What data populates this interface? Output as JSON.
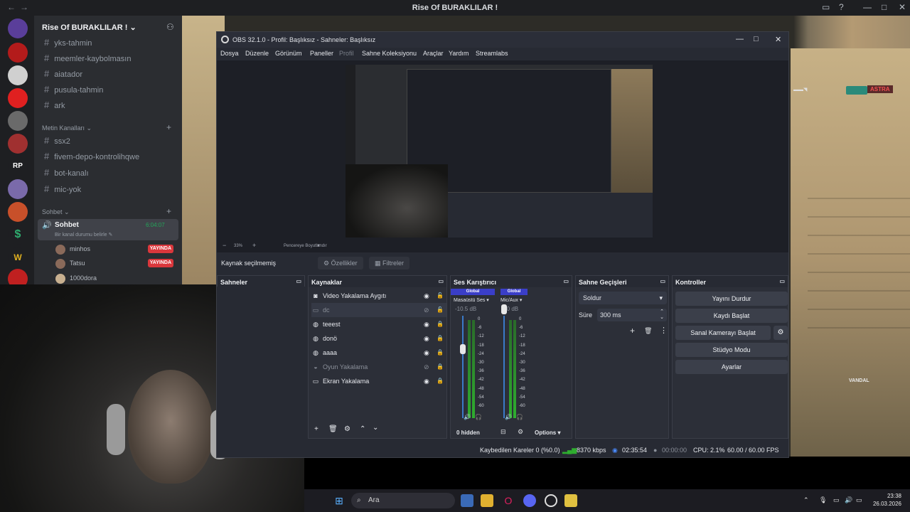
{
  "discord": {
    "window_title": "Rise Of BURAKLILAR !",
    "guild_name": "Rise Of BURAKLILAR !",
    "channels_top": [
      "yks-tahmin",
      "meemler-kaybolmasın",
      "aiatador",
      "pusula-tahmin",
      "ark"
    ],
    "category1": "Metin Kanalları",
    "channels_mid": [
      "ssx2",
      "fivem-depo-kontrolihqwe",
      "bot-kanalı",
      "mic-yok"
    ],
    "category2": "Sohbet",
    "voice_channel": "Sohbet",
    "voice_status": "Bir kanal durumu belirle",
    "voice_timer": "6:04:07",
    "voice_users": [
      {
        "name": "minhos",
        "badge": "YAYINDA"
      },
      {
        "name": "Tatsu",
        "badge": "YAYINDA"
      },
      {
        "name": "1000dora",
        "badge": ""
      }
    ]
  },
  "obs": {
    "title": "OBS 32.1.0 - Profil: Başlıksız - Sahneler: Başlıksız",
    "menu": [
      "Dosya",
      "Düzenle",
      "Görünüm",
      "Paneller",
      "Profil",
      "Sahne Koleksiyonu",
      "Araçlar",
      "Yardım",
      "Streamlabs"
    ],
    "preview_zoom": "33%",
    "preview_fit": "Pencereye Boyutlandır",
    "no_source": "Kaynak seçilmemiş",
    "properties": "Özellikler",
    "filters": "Filtreler",
    "docks": {
      "scenes": "Sahneler",
      "sources": "Kaynaklar",
      "mixer": "Ses Karıştırıcı",
      "transitions": "Sahne Geçişleri",
      "controls": "Kontroller"
    },
    "sources": [
      {
        "name": "Video Yakalama Aygıtı",
        "icon": "camera-icon",
        "visible": true,
        "locked": false,
        "dim": false
      },
      {
        "name": "dc",
        "icon": "window-icon",
        "visible": false,
        "locked": false,
        "dim": true
      },
      {
        "name": "teeest",
        "icon": "globe-icon",
        "visible": true,
        "locked": true,
        "dim": false
      },
      {
        "name": "donö",
        "icon": "globe-icon",
        "visible": true,
        "locked": true,
        "dim": false
      },
      {
        "name": "aaaa",
        "icon": "globe-icon",
        "visible": true,
        "locked": true,
        "dim": false
      },
      {
        "name": "Oyun Yakalama",
        "icon": "gamepad-icon",
        "visible": false,
        "locked": true,
        "dim": true
      },
      {
        "name": "Ekran Yakalama",
        "icon": "monitor-icon",
        "visible": true,
        "locked": true,
        "dim": false
      }
    ],
    "mixer": {
      "ch1": {
        "badge": "Global",
        "name": "Masaüstü Ses",
        "db": "-10.5 dB"
      },
      "ch2": {
        "badge": "Global",
        "name": "Mic/Aux",
        "db": "0.0 dB"
      },
      "ticks": [
        "0",
        "-6",
        "-12",
        "-18",
        "-24",
        "-30",
        "-36",
        "-42",
        "-48",
        "-54",
        "-60"
      ],
      "hidden": "0 hidden",
      "options": "Options",
      "ch1_level": 0.28,
      "ch2_level": 0.0
    },
    "transitions": {
      "selected": "Soldur",
      "duration_label": "Süre",
      "duration": "300 ms"
    },
    "controls": [
      "Yayını Durdur",
      "Kaydı Başlat",
      "Sanal Kamerayı Başlat",
      "Stüdyo Modu",
      "Ayarlar"
    ],
    "status": {
      "dropped": "Kaybedilen Kareler 0 (%0.0)",
      "bitrate": "8370 kbps",
      "stream_time": "02:35:54",
      "rec_time": "00:00:00",
      "cpu": "CPU: 2.1%",
      "fps": "60.00 / 60.00 FPS"
    }
  },
  "game": {
    "hud_agent": "ASTRA",
    "hud_weapon": "VANDAL"
  },
  "taskbar": {
    "search": "Ara",
    "time": "23:38",
    "date": "26.03.2026"
  },
  "colors": {
    "accent_green": "#23a559",
    "live_red": "#da373c",
    "obs_bg": "#272a33"
  }
}
